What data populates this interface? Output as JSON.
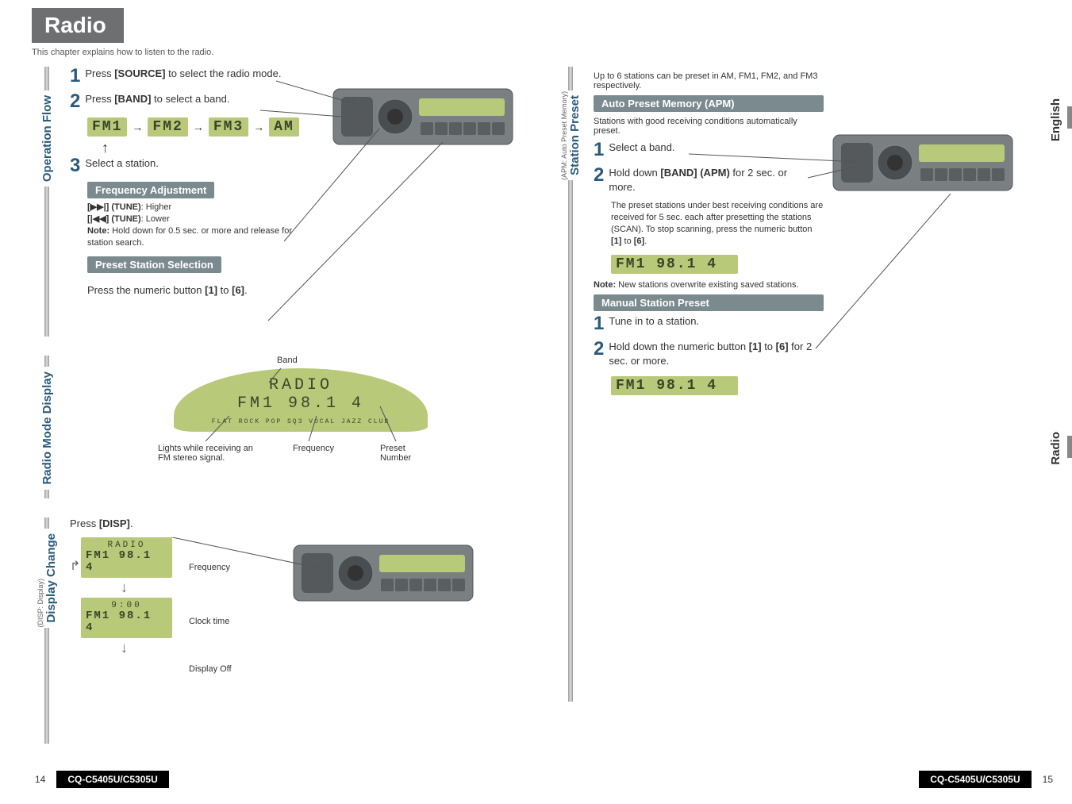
{
  "title": "Radio",
  "intro": "This chapter explains how to listen to the radio.",
  "sections": {
    "operation_flow": {
      "tab": "Operation Flow",
      "step1": "Press [SOURCE] to select the radio mode.",
      "step2": "Press [BAND] to select a band.",
      "bands": [
        "FM1",
        "FM2",
        "FM3",
        "AM"
      ],
      "step3": "Select a station.",
      "freq_adj_head": "Frequency Adjustment",
      "freq_adj_body_l1": "[▶▶|] (TUNE): Higher",
      "freq_adj_body_l2": "[|◀◀] (TUNE): Lower",
      "freq_adj_note": "Note: Hold down for 0.5 sec. or more and release for station search.",
      "preset_sel_head": "Preset Station Selection",
      "preset_sel_body": "Press the numeric button [1] to [6]."
    },
    "radio_mode_display": {
      "tab": "Radio Mode Display",
      "callout_band": "Band",
      "callout_stereo": "Lights while receiving an FM stereo signal.",
      "callout_frequency": "Frequency",
      "callout_preset": "Preset Number",
      "lcd_title": "RADIO",
      "lcd_line": "FM1   98.1  4",
      "lcd_icons": "FLAT  ROCK  POP  SQ3  VOCAL  JAZZ  CLUB"
    },
    "display_change": {
      "tab": "Display Change",
      "sub": "(DISP: Display)",
      "press": "Press [DISP].",
      "state1_l1": "RADIO",
      "state1_l2": "FM1  98.1  4",
      "label1": "Frequency",
      "state2_l1": "9:00",
      "state2_l2": "FM1  98.1  4",
      "label2": "Clock time",
      "label3": "Display Off"
    },
    "station_preset": {
      "tab": "Station Preset",
      "sub": "(APM: Auto Preset Memory)",
      "intro": "Up to 6 stations can be preset in AM, FM1, FM2, and FM3 respectively.",
      "apm_head": "Auto Preset Memory (APM)",
      "apm_intro": "Stations with good receiving conditions automatically preset.",
      "apm_step1": "Select a band.",
      "apm_step2": "Hold down [BAND] (APM) for 2 sec. or more.",
      "apm_note": "The preset stations under best receiving conditions are received for 5 sec. each after presetting the stations (SCAN). To stop scanning, press the numeric button [1] to [6].",
      "apm_lcd": "FM1  98.1  4",
      "overwrite_note": "Note: New stations overwrite existing saved stations.",
      "manual_head": "Manual Station Preset",
      "manual_step1": "Tune in to a station.",
      "manual_step2": "Hold down the numeric button [1] to [6] for 2 sec. or more.",
      "manual_lcd": "FM1  98.1  4"
    }
  },
  "side_labels": {
    "english": "English",
    "radio": "Radio"
  },
  "footer": {
    "page_left": "14",
    "page_right": "15",
    "model": "CQ-C5405U/C5305U"
  }
}
